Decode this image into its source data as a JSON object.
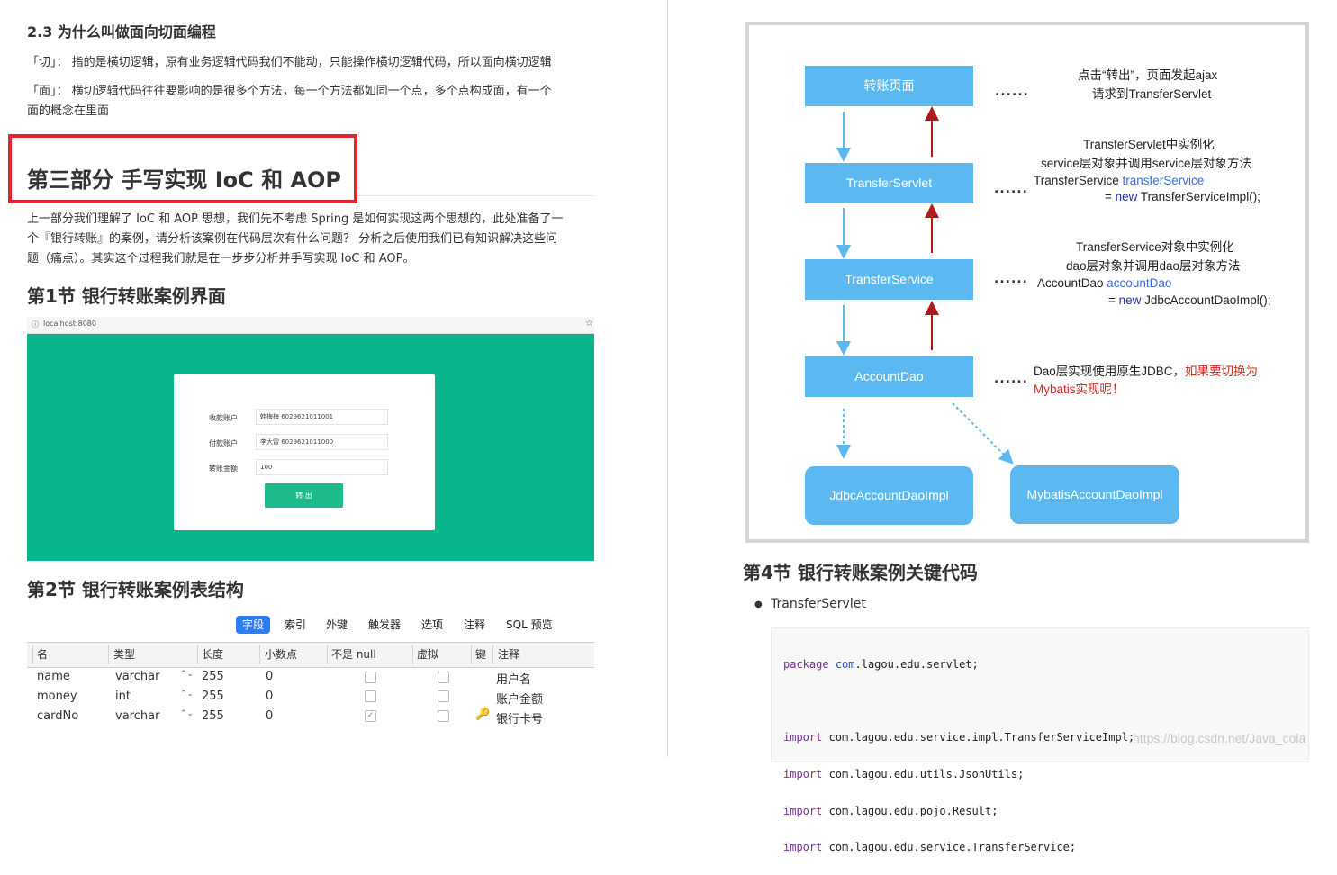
{
  "left": {
    "section_heading": "2.3 为什么叫做面向切面编程",
    "para_qie": "「切」： 指的是横切逻辑，原有业务逻辑代码我们不能动，只能操作横切逻辑代码，所以面向横切逻辑",
    "para_mian_1": "「面」： 横切逻辑代码往往要影响的是很多个方法，每一个方法都如同一个点，多个点构成面，有一个",
    "para_mian_2": "面的概念在里面",
    "part_title": "第三部分 手写实现 IoC 和 AOP",
    "intro_1": "上一部分我们理解了 IoC 和 AOP 思想，我们先不考虑 Spring 是如何实现这两个思想的，此处准备了一",
    "intro_2": "个『银行转账』的案例，请分析该案例在代码层次有什么问题？ 分析之后使用我们已有知识解决这些问",
    "intro_3": "题（痛点）。其实这个过程我们就是在一步步分析并手写实现 IoC 和 AOP。",
    "sec1_title": "第1节 银行转账案例界面",
    "browser": {
      "url_icon": "ⓘ",
      "url": "localhost:8080",
      "star": "☆"
    },
    "form": {
      "fields": [
        {
          "label": "收款账户",
          "value": "韩梅梅 6029621011001"
        },
        {
          "label": "付款账户",
          "value": "李大雷 6029621011000"
        },
        {
          "label": "转账金额",
          "value": "100"
        }
      ],
      "submit": "转 出"
    },
    "sec2_title": "第2节 银行转账案例表结构",
    "tabs": [
      "字段",
      "索引",
      "外键",
      "触发器",
      "选项",
      "注释",
      "SQL 预览"
    ],
    "columns": [
      "名",
      "类型",
      "长度",
      "小数点",
      "不是 null",
      "虚拟",
      "键",
      "注释"
    ],
    "rows": [
      {
        "name": "name",
        "type": "varchar",
        "length": "255",
        "decimal": "0",
        "not_null": false,
        "virtual": false,
        "key": false,
        "comment": "用户名"
      },
      {
        "name": "money",
        "type": "int",
        "length": "255",
        "decimal": "0",
        "not_null": false,
        "virtual": false,
        "key": false,
        "comment": "账户金额"
      },
      {
        "name": "cardNo",
        "type": "varchar",
        "length": "255",
        "decimal": "0",
        "not_null": true,
        "virtual": false,
        "key": true,
        "comment": "银行卡号"
      }
    ],
    "check_mark": "✓",
    "key_icon": "🔑",
    "stepper": "⌃⌄"
  },
  "diagram": {
    "boxes": {
      "page": "转账页面",
      "servlet": "TransferServlet",
      "service": "TransferService",
      "dao": "AccountDao",
      "jdbc": "JdbcAccountDaoImpl",
      "mybatis": "MybatisAccountDaoImpl"
    },
    "dots": "......",
    "notes": {
      "n1_1": "点击“转出”，页面发起ajax",
      "n1_2": "请求到TransferServlet",
      "n2_1": "TransferServlet中实例化",
      "n2_2": "service层对象并调用service层对象方法",
      "n2_3a": "TransferService ",
      "n2_3b": "transferService",
      "n2_4a": "= ",
      "n2_4b": "new",
      "n2_4c": " TransferServiceImpl();",
      "n3_1": "TransferService对象中实例化",
      "n3_2": "dao层对象并调用dao层对象方法",
      "n3_3a": "AccountDao ",
      "n3_3b": "accountDao",
      "n3_4a": "= ",
      "n3_4b": "new",
      "n3_4c": " JdbcAccountDaoImpl();",
      "n4_1a": "Dao层实现使用原生JDBC，",
      "n4_1b": "如果要切换为",
      "n4_2": "Mybatis实现呢！"
    },
    "colors": {
      "box": "#5bb8f0",
      "down_arrow": "#5bb8f0",
      "up_arrow": "#b0191b"
    }
  },
  "right": {
    "sec4_title": "第4节 银行转账案例关键代码",
    "bullet": "TransferServlet",
    "code": [
      {
        "kw": "package",
        "rest_pk": "com",
        "rest": ".lagou.edu.servlet;"
      },
      {
        "kw": "",
        "rest_pk": "",
        "rest": ""
      },
      {
        "kw": "import",
        "rest_pk": "",
        "rest": " com.lagou.edu.service.impl.TransferServiceImpl;"
      },
      {
        "kw": "import",
        "rest_pk": "",
        "rest": " com.lagou.edu.utils.JsonUtils;"
      },
      {
        "kw": "import",
        "rest_pk": "",
        "rest": " com.lagou.edu.pojo.Result;"
      },
      {
        "kw": "import",
        "rest_pk": "",
        "rest": " com.lagou.edu.service.TransferService;"
      }
    ],
    "watermark": "https://blog.csdn.net/Java_cola"
  }
}
